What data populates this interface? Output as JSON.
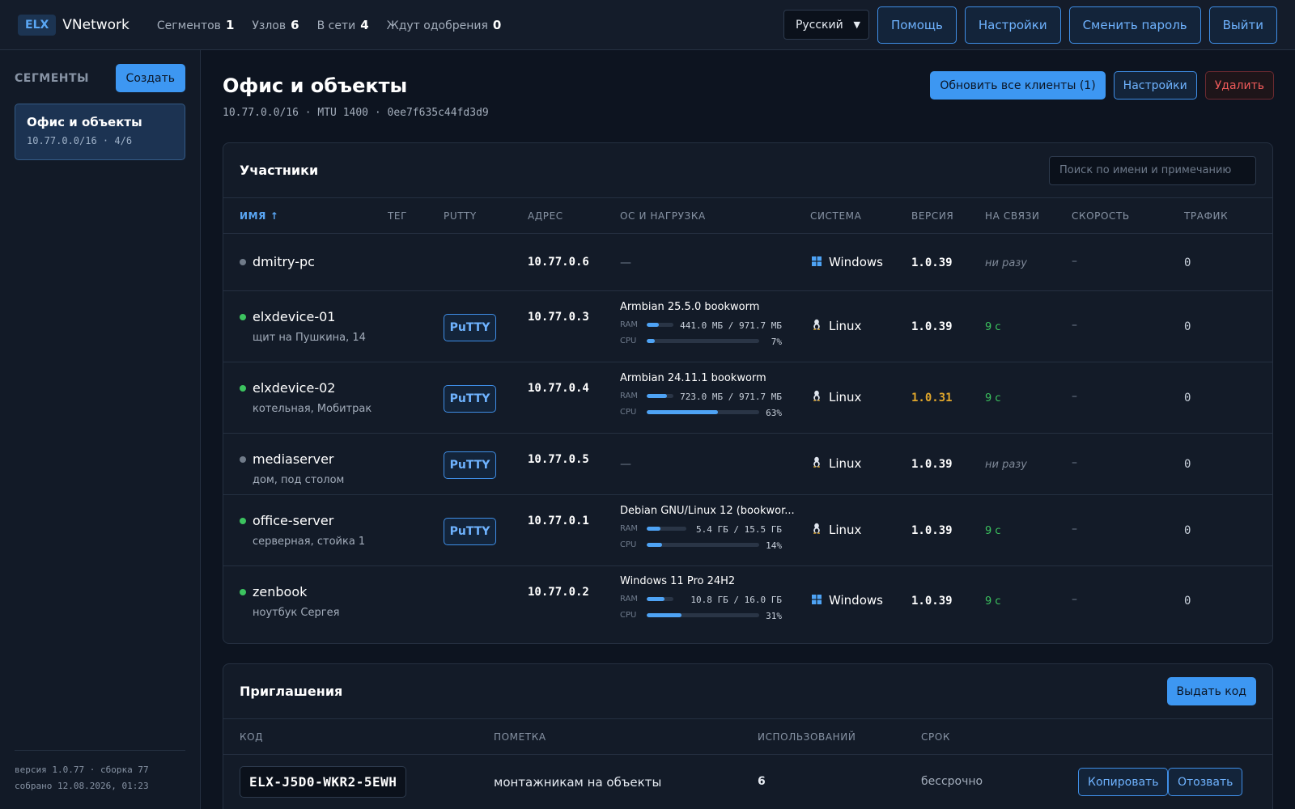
{
  "header": {
    "logo": "ELX",
    "app_name": "VNetwork",
    "stats": [
      {
        "label": "Сегментов",
        "value": "1"
      },
      {
        "label": "Узлов",
        "value": "6"
      },
      {
        "label": "В сети",
        "value": "4"
      },
      {
        "label": "Ждут одобрения",
        "value": "0"
      }
    ],
    "language": "Русский",
    "help": "Помощь",
    "settings": "Настройки",
    "change_password": "Сменить пароль",
    "logout": "Выйти"
  },
  "sidebar": {
    "title": "СЕГМЕНТЫ",
    "create": "Создать",
    "segments": [
      {
        "name": "Офис и объекты",
        "sub": "10.77.0.0/16 · 4/6"
      }
    ],
    "version": "версия 1.0.77 · сборка 77",
    "built": "собрано 12.08.2026, 01:23"
  },
  "page": {
    "title": "Офис и объекты",
    "subtitle": "10.77.0.0/16 · MTU 1400 · 0ee7f635c44fd3d9",
    "update_all": "Обновить все клиенты (1)",
    "settings": "Настройки",
    "delete": "Удалить"
  },
  "members": {
    "title": "Участники",
    "search_placeholder": "Поиск по имени и примечанию",
    "columns": {
      "name": "ИМЯ ↑",
      "tag": "ТЕГ",
      "putty": "PUTTY",
      "address": "АДРЕС",
      "os": "ОС И НАГРУЗКА",
      "system": "СИСТЕМА",
      "version": "ВЕРСИЯ",
      "seen": "НА СВЯЗИ",
      "speed": "СКОРОСТЬ",
      "traffic": "ТРАФИК"
    },
    "putty_label": "PuTTY",
    "ram_label": "RAM",
    "cpu_label": "CPU",
    "rows": [
      {
        "name": "dmitry-pc",
        "note": "",
        "online": false,
        "putty": false,
        "address": "10.77.0.6",
        "os": "—",
        "ram": "",
        "ram_frac": 0,
        "cpu": "",
        "cpu_frac": 0,
        "system": "Windows",
        "system_icon": "windows-icon",
        "version": "1.0.39",
        "outdated": false,
        "seen": "ни разу",
        "speed": "–",
        "traffic": "0"
      },
      {
        "name": "elxdevice-01",
        "note": "щит на Пушкина, 14",
        "online": true,
        "putty": true,
        "address": "10.77.0.3",
        "os": "Armbian 25.5.0 bookworm",
        "ram": "441.0 МБ / 971.7 МБ",
        "ram_frac": 0.454,
        "cpu": "7%",
        "cpu_frac": 0.07,
        "system": "Linux",
        "system_icon": "linux-icon",
        "version": "1.0.39",
        "outdated": false,
        "seen": "9 с",
        "speed": "–",
        "traffic": "0"
      },
      {
        "name": "elxdevice-02",
        "note": "котельная, Мобитрак",
        "online": true,
        "putty": true,
        "address": "10.77.0.4",
        "os": "Armbian 24.11.1 bookworm",
        "ram": "723.0 МБ / 971.7 МБ",
        "ram_frac": 0.744,
        "cpu": "63%",
        "cpu_frac": 0.63,
        "system": "Linux",
        "system_icon": "linux-icon",
        "version": "1.0.31",
        "outdated": true,
        "seen": "9 с",
        "speed": "–",
        "traffic": "0"
      },
      {
        "name": "mediaserver",
        "note": "дом, под столом",
        "online": false,
        "putty": true,
        "address": "10.77.0.5",
        "os": "—",
        "ram": "",
        "ram_frac": 0,
        "cpu": "",
        "cpu_frac": 0,
        "system": "Linux",
        "system_icon": "linux-icon",
        "version": "1.0.39",
        "outdated": false,
        "seen": "ни разу",
        "speed": "–",
        "traffic": "0"
      },
      {
        "name": "office-server",
        "note": "серверная, стойка 1",
        "online": true,
        "putty": true,
        "address": "10.77.0.1",
        "os": "Debian GNU/Linux 12 (bookwor...",
        "ram": "5.4 ГБ / 15.5 ГБ",
        "ram_frac": 0.348,
        "cpu": "14%",
        "cpu_frac": 0.14,
        "system": "Linux",
        "system_icon": "linux-icon",
        "version": "1.0.39",
        "outdated": false,
        "seen": "9 с",
        "speed": "–",
        "traffic": "0"
      },
      {
        "name": "zenbook",
        "note": "ноутбук Сергея",
        "online": true,
        "putty": false,
        "address": "10.77.0.2",
        "os": "Windows 11 Pro 24H2",
        "ram": "10.8 ГБ / 16.0 ГБ",
        "ram_frac": 0.675,
        "cpu": "31%",
        "cpu_frac": 0.31,
        "system": "Windows",
        "system_icon": "windows-icon",
        "version": "1.0.39",
        "outdated": false,
        "seen": "9 с",
        "speed": "–",
        "traffic": "0"
      }
    ]
  },
  "invites": {
    "title": "Приглашения",
    "issue_code": "Выдать код",
    "columns": {
      "code": "КОД",
      "note": "ПОМЕТКА",
      "uses": "ИСПОЛЬЗОВАНИЙ",
      "expiry": "СРОК"
    },
    "rows": [
      {
        "code": "ELX-J5D0-WKR2-5EWH",
        "note": "монтажникам на объекты",
        "uses": "6",
        "expiry": "бессрочно",
        "copy": "Копировать",
        "revoke": "Отозвать"
      }
    ]
  },
  "colors": {
    "accent": "#3d97f2",
    "online": "#3cc35f",
    "offline": "#707b89",
    "outdated_version": "#e1a72b",
    "danger": "#ef5a5a"
  }
}
